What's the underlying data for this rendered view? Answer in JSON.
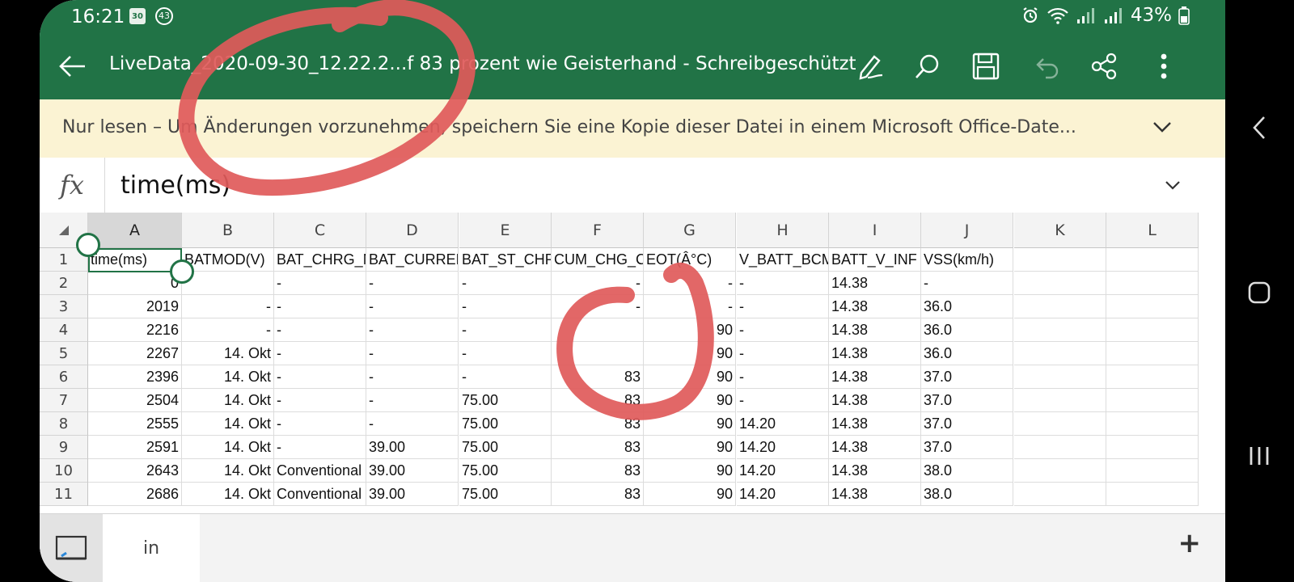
{
  "status_bar": {
    "time": "16:21",
    "calendar_day": "30",
    "badge_count": "43",
    "battery": "43%"
  },
  "app_bar": {
    "title": "LiveData_2020-09-30_12.22.2...f 83 prozent wie Geisterhand - Schreibgeschützt"
  },
  "banner": {
    "text": "Nur lesen – Um Änderungen vorzunehmen, speichern Sie eine Kopie dieser Datei in einem Microsoft Office-Date..."
  },
  "formula_bar": {
    "fx_label": "fx",
    "value": "time(ms)"
  },
  "sheet": {
    "column_headers": [
      "A",
      "B",
      "C",
      "D",
      "E",
      "F",
      "G",
      "H",
      "I",
      "J",
      "K",
      "L"
    ],
    "row_numbers": [
      "1",
      "2",
      "3",
      "4",
      "5",
      "6",
      "7",
      "8",
      "9",
      "10",
      "11"
    ],
    "rows": [
      [
        "time(ms)",
        "BATMOD(V)",
        "BAT_CHRG_MODE",
        "BAT_CURRENT",
        "BAT_ST_CHRG",
        "CUM_CHG_C",
        "EOT(Â°C)",
        "V_BATT_BCM",
        "BATT_V_INF",
        "VSS(km/h)",
        "",
        ""
      ],
      [
        "0",
        "",
        "-",
        "-",
        "-",
        "-",
        "-",
        "-",
        "14.38",
        "-",
        "",
        ""
      ],
      [
        "2019",
        "-",
        "-",
        "-",
        "-",
        "-",
        "-",
        "-",
        "14.38",
        "36.0",
        "",
        ""
      ],
      [
        "2216",
        "-",
        "-",
        "-",
        "-",
        "",
        "90",
        "-",
        "14.38",
        "36.0",
        "",
        ""
      ],
      [
        "2267",
        "14. Okt",
        "-",
        "-",
        "-",
        "",
        "90",
        "-",
        "14.38",
        "36.0",
        "",
        ""
      ],
      [
        "2396",
        "14. Okt",
        "-",
        "-",
        "-",
        "83",
        "90",
        "-",
        "14.38",
        "37.0",
        "",
        ""
      ],
      [
        "2504",
        "14. Okt",
        "-",
        "-",
        "75.00",
        "83",
        "90",
        "-",
        "14.38",
        "37.0",
        "",
        ""
      ],
      [
        "2555",
        "14. Okt",
        "-",
        "-",
        "75.00",
        "83",
        "90",
        "14.20",
        "14.38",
        "37.0",
        "",
        ""
      ],
      [
        "2591",
        "14. Okt",
        "-",
        "39.00",
        "75.00",
        "83",
        "90",
        "14.20",
        "14.38",
        "37.0",
        "",
        ""
      ],
      [
        "2643",
        "14. Okt",
        "Conventional",
        "39.00",
        "75.00",
        "83",
        "90",
        "14.20",
        "14.38",
        "38.0",
        "",
        ""
      ],
      [
        "2686",
        "14. Okt",
        "Conventional",
        "39.00",
        "75.00",
        "83",
        "90",
        "14.20",
        "14.38",
        "38.0",
        "",
        ""
      ]
    ],
    "selected_cell": "A1",
    "selected_column": "A"
  },
  "sheet_tabs": {
    "active_tab": "in",
    "add_label": "+"
  },
  "colors": {
    "excel_green": "#217346",
    "banner_bg": "#fbf3d3",
    "annotation_red": "#e05a5a"
  }
}
